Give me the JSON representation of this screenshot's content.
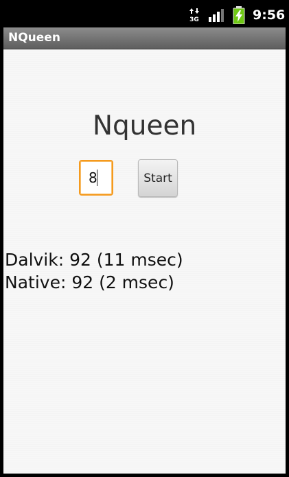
{
  "status_bar": {
    "time": "9:56",
    "network_label": "3G",
    "icons": [
      "network-3g-icon",
      "signal-icon",
      "battery-charging-icon"
    ],
    "battery_color": "#6fc814"
  },
  "app": {
    "title": "NQueen",
    "heading": "Nqueen"
  },
  "form": {
    "n_value": "8",
    "start_label": "Start",
    "focus_color": "#f59a1d"
  },
  "results": {
    "dalvik": "Dalvik: 92 (11 msec)",
    "native": "Native: 92 (2 msec)"
  }
}
